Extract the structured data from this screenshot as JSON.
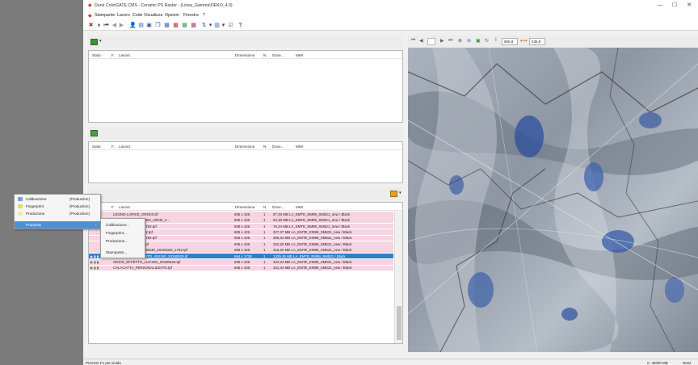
{
  "window": {
    "title": "Durst ColorGATE CMS - Ceramic PS Raster - (Linea_Gamma\\OEKO_4.0)",
    "controls": {
      "minimize": "—",
      "maximize": "☐",
      "close": "✕"
    }
  },
  "menubar": {
    "items": [
      "Stampante",
      "Lavoro",
      "Code",
      "Visualizza",
      "Opzioni",
      "Finestra",
      "?"
    ]
  },
  "queue_panel": {
    "columns": {
      "state": "Stato",
      "number": "F.",
      "job": "Lavoro",
      "size": "Dimensione",
      "n": "N.",
      "done": "Dove...",
      "mm": "MIM"
    }
  },
  "job_list": {
    "rows": [
      {
        "state": "",
        "job": "LEGNO-LARICE_GRIGIO.tif",
        "size": "605 x 425",
        "n": "1",
        "info": "97,33 MB LA_EMTE_EM99_SM521_new / Black",
        "style": "pink"
      },
      {
        "state": "",
        "job": "...NDO_AZZURRO_062_40040_2...",
        "size": "605 x 425",
        "n": "1",
        "info": "84,30 MB LA_EMTE_EM99_SM521_new / Black",
        "style": "pink"
      },
      {
        "state": "",
        "job": "...0040_20181022_1762.tpf",
        "size": "605 x 425",
        "n": "1",
        "info": "76,34 MB LA_EMTE_EM99_SM521_new / Black",
        "style": "pink"
      },
      {
        "state": "",
        "job": "...30_20181022_1762.tpf",
        "size": "605 x 425",
        "n": "1",
        "info": "327,37 MB LA_EMTE_EM99_SM521_new / Black",
        "style": "pink"
      },
      {
        "state": "",
        "job": "...0040_20181022_1762.tpf",
        "size": "605 x 425",
        "n": "1",
        "info": "306,34 MB LA_EMTE_EM99_SM521_new / Black",
        "style": "pink"
      },
      {
        "state": "",
        "job": "..._20181022_1762.tpf",
        "size": "605 x 425",
        "n": "1",
        "info": "322,29 MB LA_EMTE_EM99_SM521_new / Black",
        "style": "pink"
      },
      {
        "state": "",
        "job": "...COCCIO_BEIGE_40040_20181022_1762.tpf",
        "size": "605 x 425",
        "n": "1",
        "info": "315,25 MB LA_EMTE_EM99_SM521_new / Black",
        "style": "pink"
      },
      {
        "state": "▶ ▮ ▮",
        "job": "BLUE_EYES_GRANITO_40X160_20180529.tif",
        "size": "664 x 1728",
        "n": "1",
        "info": "1335,36 MB LA_EMTE_EM99_SM521 / Black",
        "style": "sel"
      },
      {
        "state": "▶ ▮ ▮",
        "job": "ONICE_EFFETTO_LUCIDO_20180529.tpf",
        "size": "605 x 425",
        "n": "1",
        "info": "323,23 MB LA_EMTE_EM99_SM521_new / Black",
        "style": "pink"
      },
      {
        "state": "▶ ▮ ▮",
        "job": "CALACATTA_PERSONALIZZATO.tpf",
        "size": "605 x 425",
        "n": "1",
        "info": "321,34 MB LA_EMTE_EM99_SM521_new / Black",
        "style": "pink"
      }
    ]
  },
  "image_toolbar": {
    "width_value": "655,8",
    "height_value": "435,8"
  },
  "context_menu": {
    "items": [
      {
        "label": "Calibrazione",
        "value": "(Production)",
        "color": "#7b9fe0"
      },
      {
        "label": "Fingerprint",
        "value": "(Production)",
        "color": "#e6d96a"
      },
      {
        "label": "Produzione",
        "value": "(Production)",
        "color": "#f4eaa0"
      },
      {
        "label": "Proprietà",
        "value": "",
        "color": ""
      }
    ]
  },
  "submenu": {
    "items": [
      "Calibrazione...",
      "Fingerprint...",
      "Produzione...",
      "Stampante..."
    ]
  },
  "statusbar": {
    "left": "Premere F1 per Guida",
    "memory": "C: 45000 MB",
    "mode": "NUM"
  }
}
